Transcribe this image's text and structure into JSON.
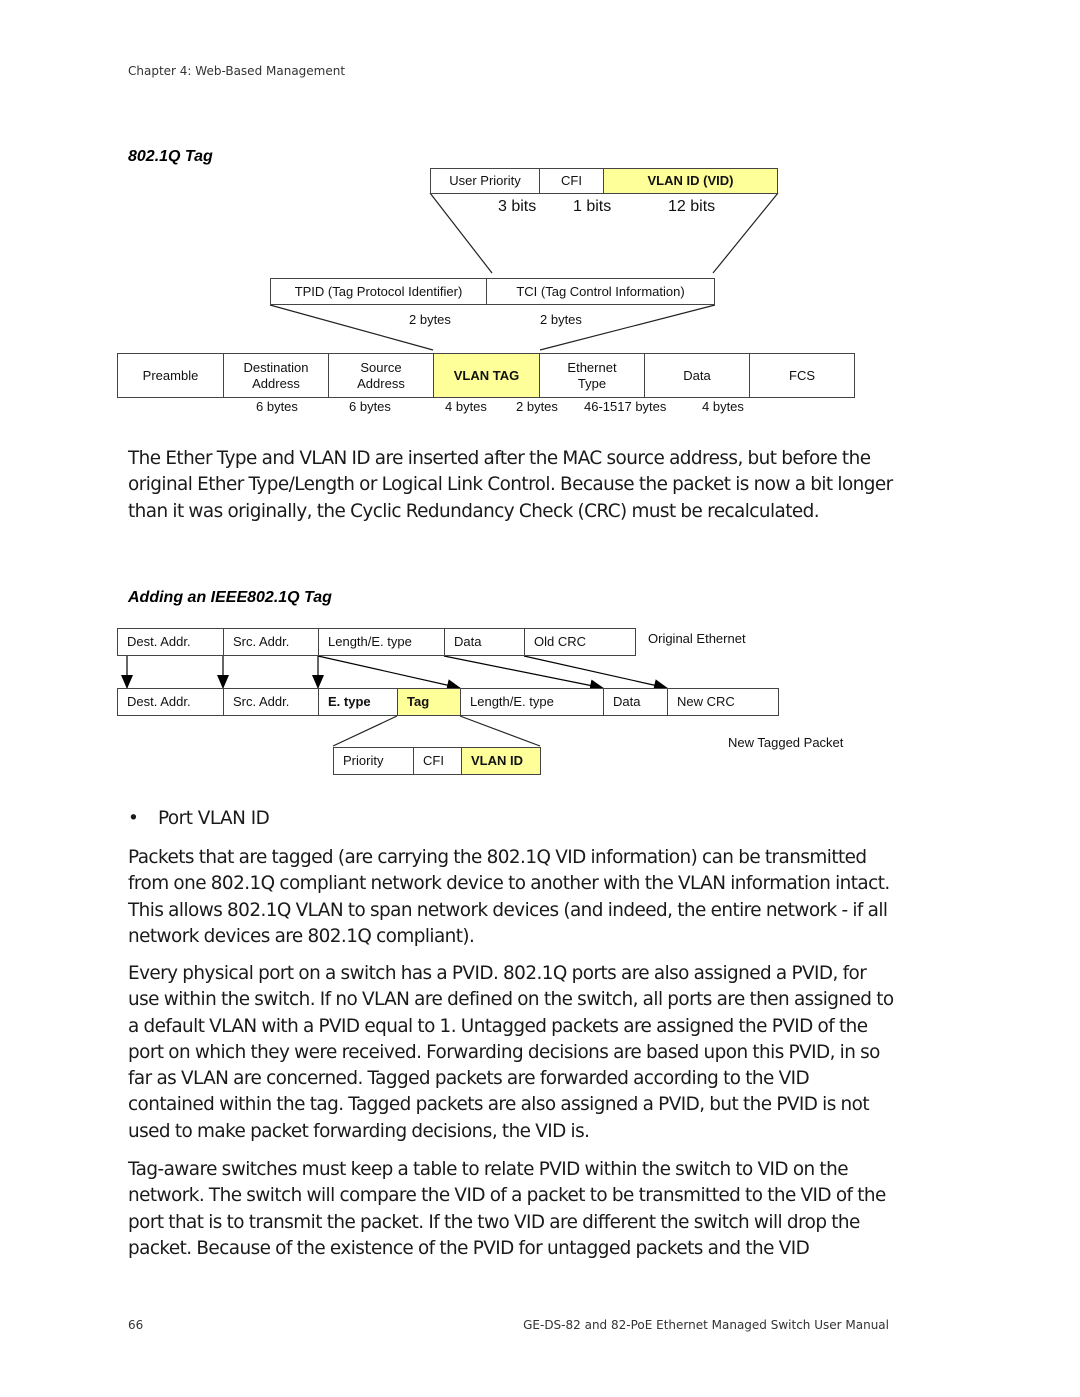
{
  "header": {
    "chapter": "Chapter 4: Web-Based Management"
  },
  "figure1": {
    "title": "802.1Q Tag",
    "tci_fields": [
      {
        "label": "User Priority",
        "highlight": false
      },
      {
        "label": "CFI",
        "highlight": false
      },
      {
        "label": "VLAN ID (VID)",
        "highlight": true
      }
    ],
    "tci_sizes": [
      "3 bits",
      "1 bits",
      "12 bits"
    ],
    "tag_fields": [
      {
        "label": "TPID (Tag Protocol Identifier)"
      },
      {
        "label": "TCI (Tag Control Information)"
      }
    ],
    "tag_sizes": [
      "2 bytes",
      "2 bytes"
    ],
    "frame_fields": [
      {
        "label": "Preamble",
        "highlight": false
      },
      {
        "label": "Destination\nAddress",
        "highlight": false
      },
      {
        "label": "Source\nAddress",
        "highlight": false
      },
      {
        "label": "VLAN TAG",
        "highlight": true
      },
      {
        "label": "Ethernet\nType",
        "highlight": false
      },
      {
        "label": "Data",
        "highlight": false
      },
      {
        "label": "FCS",
        "highlight": false
      }
    ],
    "frame_sizes": [
      "6 bytes",
      "6 bytes",
      "4 bytes",
      "2 bytes",
      "46-1517 bytes",
      "4 bytes"
    ]
  },
  "paragraph1": "The Ether Type and VLAN ID are inserted after the MAC source address, but before the original Ether Type/Length or Logical Link Control. Because the packet is now a bit longer than it was originally, the Cyclic Redundancy Check (CRC) must be recalculated.",
  "figure2": {
    "title": "Adding an IEEE802.1Q Tag",
    "original_label": "Original Ethernet",
    "original_fields": [
      "Dest. Addr.",
      "Src. Addr.",
      "Length/E. type",
      "Data",
      "Old CRC"
    ],
    "tagged_label": "New Tagged Packet",
    "tagged_fields": [
      {
        "label": "Dest. Addr.",
        "style": "normal"
      },
      {
        "label": "Src. Addr.",
        "style": "normal"
      },
      {
        "label": "E. type",
        "style": "bold"
      },
      {
        "label": "Tag",
        "style": "highlight"
      },
      {
        "label": "Length/E. type",
        "style": "normal"
      },
      {
        "label": "Data",
        "style": "normal"
      },
      {
        "label": "New CRC",
        "style": "normal"
      }
    ],
    "tag_detail_fields": [
      {
        "label": "Priority",
        "highlight": false
      },
      {
        "label": "CFI",
        "highlight": false
      },
      {
        "label": "VLAN ID",
        "highlight": true
      }
    ]
  },
  "bullet": {
    "symbol": "•",
    "text": "Port VLAN ID"
  },
  "paragraph2": "Packets that are tagged (are carrying the 802.1Q VID information) can be transmitted from one 802.1Q compliant network device to another with the VLAN information intact. This allows 802.1Q VLAN to span network devices (and indeed, the entire network - if all network devices are 802.1Q compliant).",
  "paragraph3": "Every physical port on a switch has a PVID. 802.1Q ports are also assigned a PVID, for use within the switch. If no VLAN are defined on the switch, all ports are then assigned to a default VLAN with a PVID equal to 1. Untagged packets are assigned the PVID of the port on which they were received. Forwarding decisions are based upon this PVID, in so far as VLAN are concerned. Tagged packets are forwarded according to the VID contained within the tag. Tagged packets are also assigned a PVID, but the PVID is not used to make packet forwarding decisions, the VID is.",
  "paragraph4": "Tag-aware switches must keep a table to relate PVID within the switch to VID on the network. The switch will compare the VID of a packet to be transmitted to the VID of the port that is to transmit the packet. If the two VID are different the switch will drop the packet. Because of the existence of the PVID for untagged packets and the VID",
  "footer": {
    "page_number": "66",
    "manual_title": "GE-DS-82 and 82-PoE Ethernet Managed Switch User Manual"
  }
}
